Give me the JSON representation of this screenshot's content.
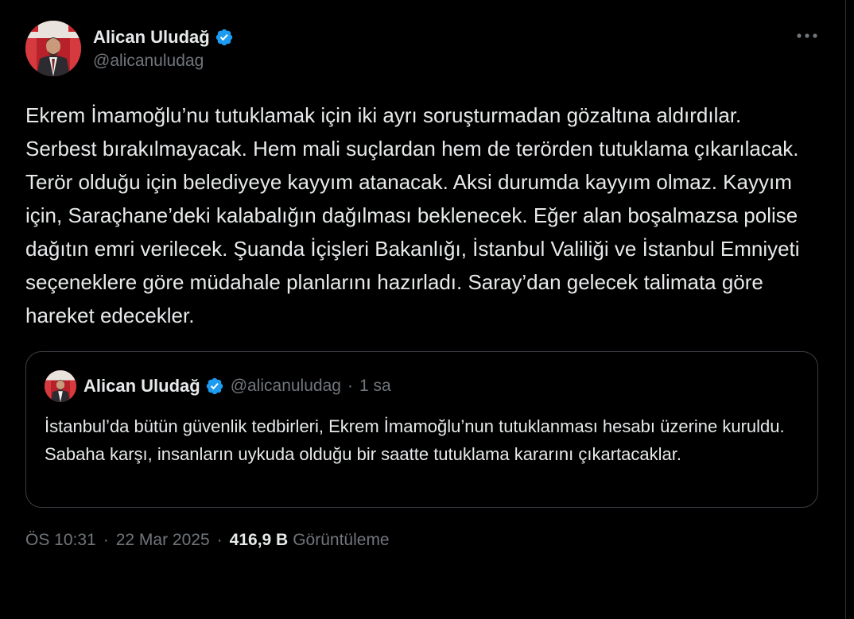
{
  "colors": {
    "background": "#000000",
    "text_primary": "#e7e9ea",
    "text_secondary": "#71767b",
    "verified_badge": "#1d9bf0",
    "border": "#3a3f44"
  },
  "author": {
    "display_name": "Alican Uludağ",
    "handle": "@alicanuludag",
    "verified_icon": "verified-badge-icon",
    "avatar_icon": "avatar"
  },
  "more_icon": "ellipsis-icon",
  "tweet": {
    "text": "Ekrem İmamoğlu’nu tutuklamak için iki ayrı soruşturmadan gözaltına aldırdılar. Serbest bırakılmayacak. Hem mali suçlardan hem de terörden tutuklama çıkarılacak. Terör olduğu için belediyeye kayyım atanacak. Aksi durumda kayyım olmaz. Kayyım için, Saraçhane’deki kalabalığın dağılması beklenecek. Eğer alan boşalmazsa polise dağıtın emri verilecek. Şuanda İçişleri Bakanlığı, İstanbul Valiliği ve İstanbul Emniyeti seçeneklere göre müdahale planlarını hazırladı. Saray’dan gelecek talimata göre hareket edecekler."
  },
  "quoted": {
    "display_name": "Alican Uludağ",
    "handle": "@alicanuludag",
    "separator": "·",
    "time_ago": "1 sa",
    "text": "İstanbul’da bütün güvenlik tedbirleri, Ekrem İmamoğlu’nun tutuklanması hesabı üzerine kuruldu. Sabaha karşı, insanların uykuda olduğu bir saatte tutuklama kararını çıkartacaklar."
  },
  "footer": {
    "time": "ÖS 10:31",
    "separator": "·",
    "date": "22 Mar 2025",
    "views_count": "416,9 B",
    "views_label": "Görüntüleme"
  }
}
